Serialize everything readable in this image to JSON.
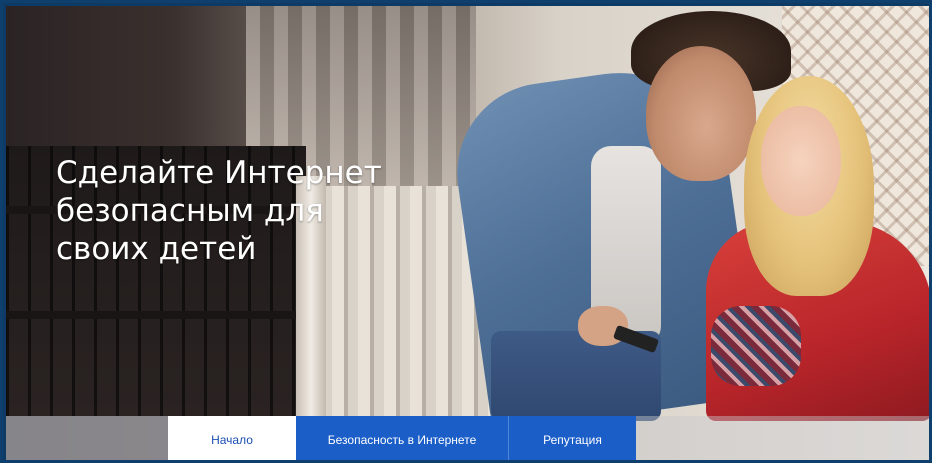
{
  "hero": {
    "headline_lines": [
      "Сделайте Интернет",
      "безопасным для",
      "своих детей"
    ]
  },
  "nav": {
    "items": [
      {
        "label": "Начало",
        "active": true
      },
      {
        "label": "Безопасность в Интернете",
        "active": false
      },
      {
        "label": "Репутация",
        "active": false
      }
    ]
  },
  "colors": {
    "frame": "#0e3f6d",
    "nav_blue": "#1b5ec8",
    "nav_active_text": "#1a4fb0",
    "headline": "#ffffff"
  }
}
